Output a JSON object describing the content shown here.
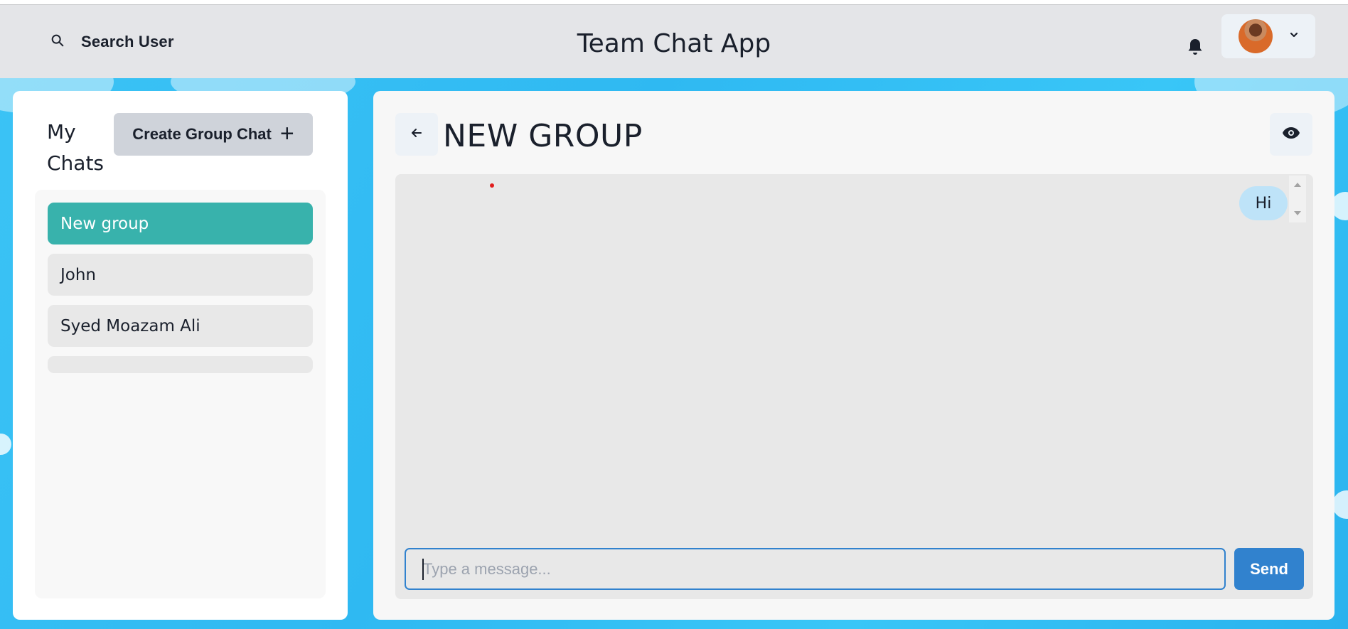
{
  "header": {
    "search_label": "Search User",
    "app_title": "Team Chat App",
    "icons": {
      "search": "search-icon",
      "bell": "bell-icon",
      "chevron": "chevron-down-icon"
    }
  },
  "sidebar": {
    "title": "My Chats",
    "create_button_label": "Create Group Chat",
    "create_button_icon": "+",
    "chats": [
      {
        "label": "New group",
        "active": true
      },
      {
        "label": "John",
        "active": false
      },
      {
        "label": "Syed Moazam Ali",
        "active": false
      }
    ]
  },
  "chat": {
    "title": "NEW GROUP",
    "messages": [
      {
        "text": "Hi",
        "from_self": true
      }
    ],
    "input_placeholder": "Type a message...",
    "input_value": "",
    "send_label": "Send"
  },
  "colors": {
    "accent": "#3182ce",
    "active_chat": "#38b2ac",
    "header_bg": "#e4e5e8",
    "background": "#2fb9f2",
    "own_message": "#bee3f8"
  }
}
